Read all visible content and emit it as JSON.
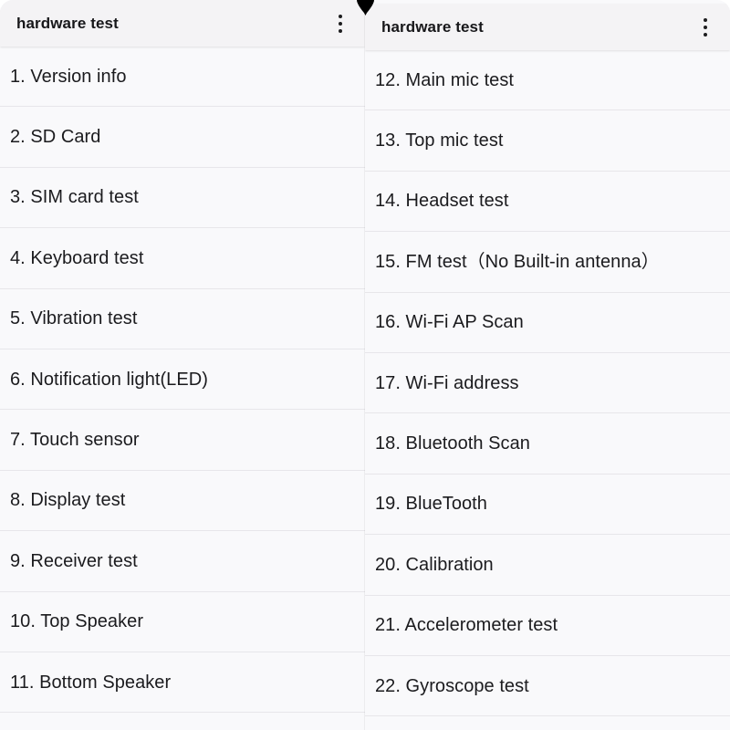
{
  "panels": [
    {
      "id": "left",
      "header": {
        "title": "hardware test",
        "overflow_icon": "more-vertical-icon"
      },
      "items": [
        {
          "label": "1. Version info"
        },
        {
          "label": "2. SD Card"
        },
        {
          "label": "3. SIM card test"
        },
        {
          "label": "4. Keyboard test"
        },
        {
          "label": "5. Vibration test"
        },
        {
          "label": "6. Notification light(LED)"
        },
        {
          "label": "7. Touch sensor"
        },
        {
          "label": "8. Display test"
        },
        {
          "label": "9. Receiver test"
        },
        {
          "label": "10. Top Speaker"
        },
        {
          "label": "11. Bottom Speaker"
        }
      ]
    },
    {
      "id": "right",
      "header": {
        "title": "hardware test",
        "overflow_icon": "more-vertical-icon"
      },
      "items": [
        {
          "label": "12. Main mic test"
        },
        {
          "label": "13. Top mic test"
        },
        {
          "label": "14. Headset test"
        },
        {
          "label": "15. FM test（No Built-in antenna）"
        },
        {
          "label": "16. Wi-Fi AP Scan"
        },
        {
          "label": "17. Wi-Fi address"
        },
        {
          "label": "18. Bluetooth Scan"
        },
        {
          "label": "19. BlueTooth"
        },
        {
          "label": "20. Calibration"
        },
        {
          "label": "21. Accelerometer test"
        },
        {
          "label": "22. Gyroscope test"
        }
      ]
    }
  ],
  "decorations": {
    "notch_icon": "camera-notch-teardrop"
  },
  "colors": {
    "appbar_background": "#f4f3f5",
    "list_background": "#f9f9fb",
    "divider": "#e7e6ea",
    "title_text": "#17171a",
    "item_text": "#1b1b1e",
    "notch": "#000000"
  }
}
